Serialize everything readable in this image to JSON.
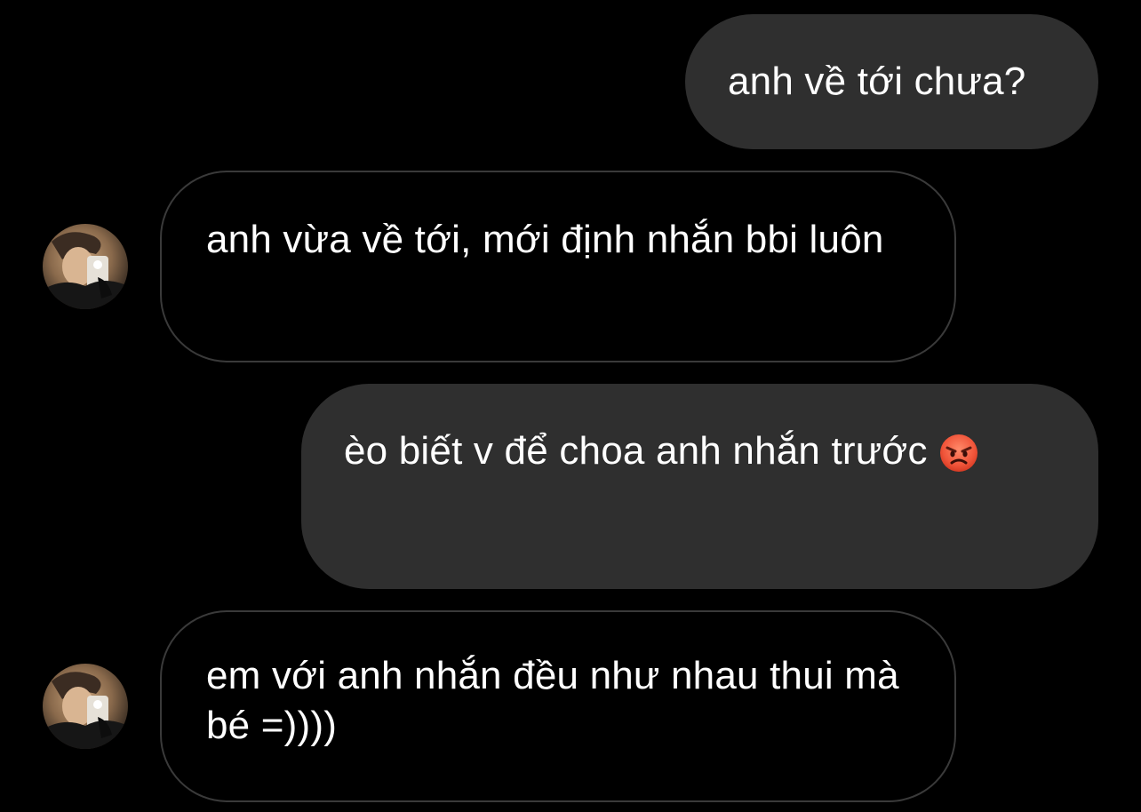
{
  "colors": {
    "background": "#000000",
    "sent_bubble": "#2f2f2f",
    "received_bubble_border": "#3a3a3a",
    "text": "#ffffff"
  },
  "messages": [
    {
      "direction": "sent",
      "text": "anh về tới chưa?"
    },
    {
      "direction": "received",
      "text": "anh vừa về tới, mới định nhắn bbi luôn",
      "avatar": "contact-avatar"
    },
    {
      "direction": "sent",
      "text": "èo biết v để choa anh nhắn trước",
      "emoji": "angry-face-emoji"
    },
    {
      "direction": "received",
      "text": "em với anh nhắn đều như nhau thui mà bé =))))",
      "avatar": "contact-avatar"
    }
  ]
}
